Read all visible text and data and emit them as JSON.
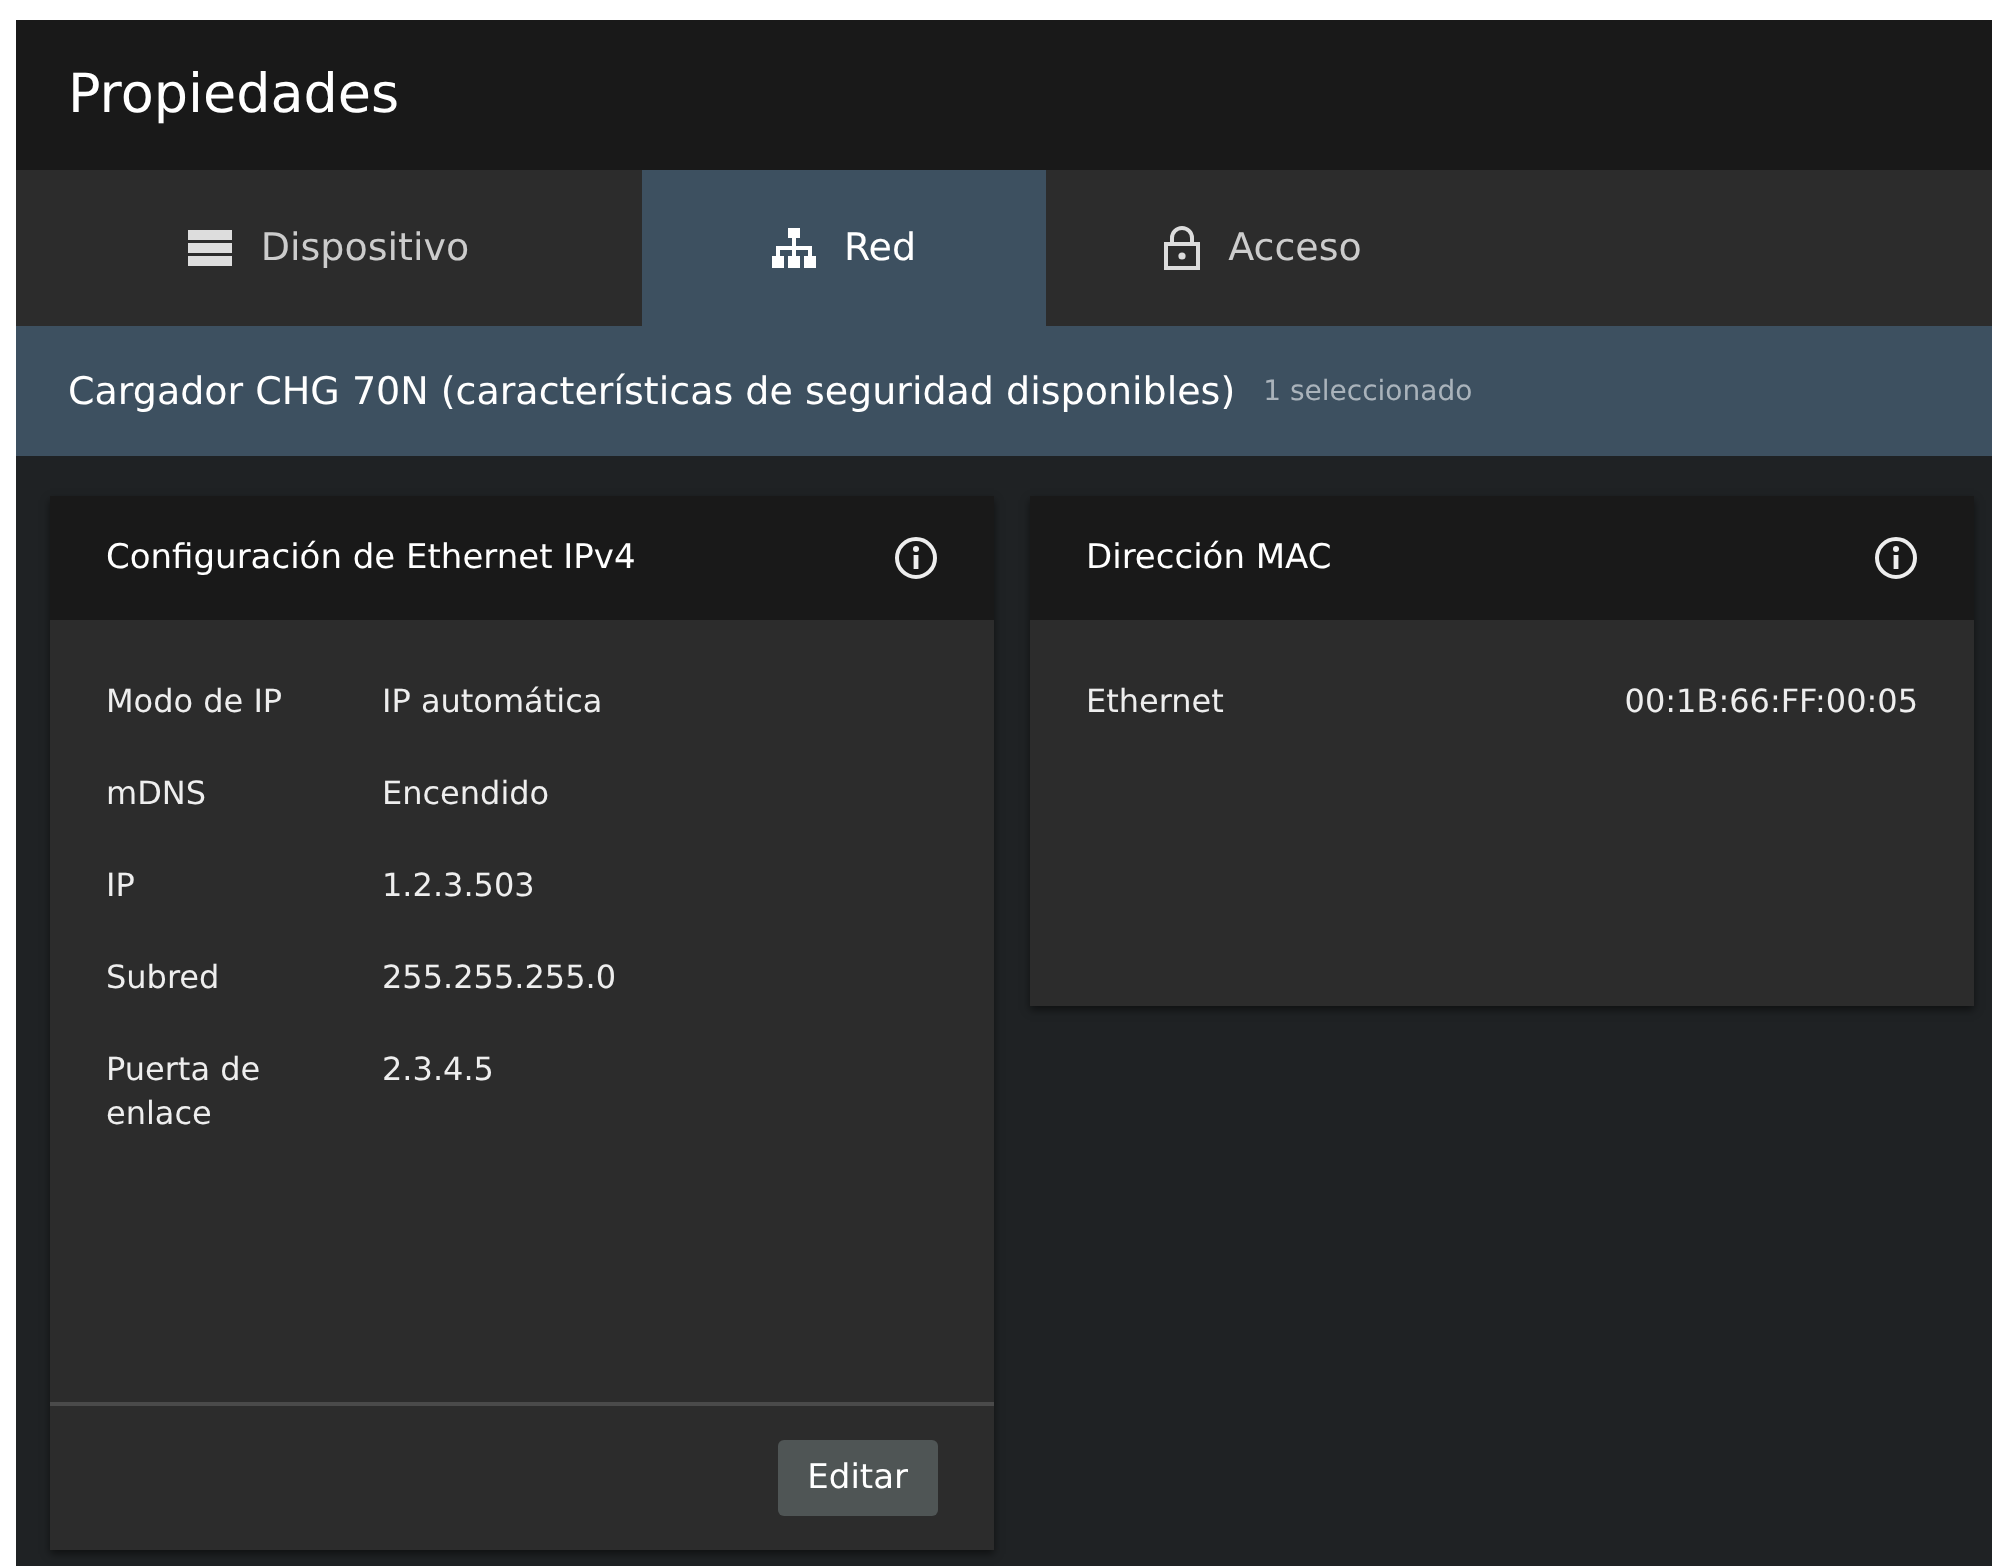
{
  "window": {
    "title": "Propiedades"
  },
  "tabs": [
    {
      "label": "Dispositivo",
      "selected": false
    },
    {
      "label": "Red",
      "selected": true
    },
    {
      "label": "Acceso",
      "selected": false
    }
  ],
  "header": {
    "title": "Cargador CHG 70N (características de seguridad disponibles)",
    "selection": "1 seleccionado"
  },
  "cards": [
    {
      "title": "Configuración de Ethernet IPv4",
      "rows": [
        {
          "label": "Modo de IP",
          "value": "IP automática"
        },
        {
          "label": "mDNS",
          "value": "Encendido"
        },
        {
          "label": "IP",
          "value": "1.2.3.503"
        },
        {
          "label": "Subred",
          "value": "255.255.255.0"
        },
        {
          "label": "Puerta de enlace",
          "value": "2.3.4.5"
        }
      ],
      "button": "Editar"
    },
    {
      "title": "Dirección MAC",
      "rows": [
        {
          "label": "Ethernet",
          "value": "00:1B:66:FF:00:05"
        }
      ]
    }
  ]
}
